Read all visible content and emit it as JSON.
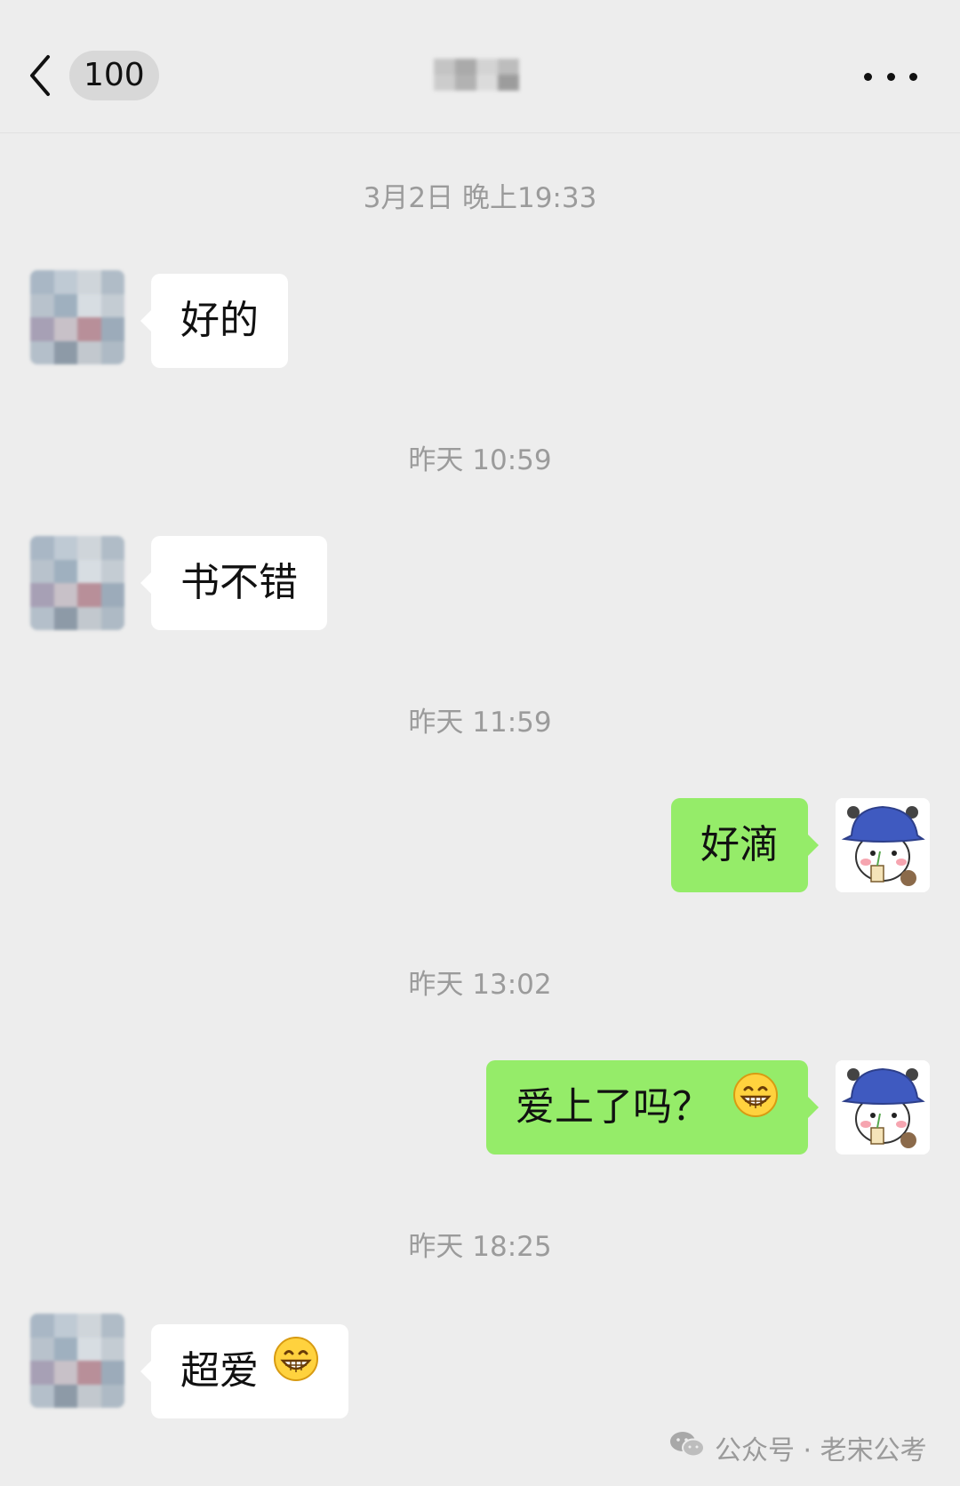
{
  "header": {
    "back_icon": "chevron-left-icon",
    "unread_count": "100",
    "more_icon": "more-dots-icon"
  },
  "messages": [
    {
      "timestamp": "3月2日 晚上19:33",
      "side": "left",
      "text": "好的"
    },
    {
      "timestamp": "昨天 10:59",
      "side": "left",
      "text": "书不错"
    },
    {
      "timestamp": "昨天 11:59",
      "side": "right",
      "text": "好滴"
    },
    {
      "timestamp": "昨天 13:02",
      "side": "right",
      "text": "爱上了吗？",
      "emoji": "grin-emoji"
    },
    {
      "timestamp": "昨天 18:25",
      "side": "left",
      "text": "超爱",
      "emoji": "grin-emoji"
    }
  ],
  "watermark": {
    "text": "公众号 · 老宋公考",
    "icon": "wechat-icon"
  },
  "colors": {
    "background": "#ededed",
    "bubble_self": "#95ec69",
    "bubble_other": "#ffffff",
    "timestamp": "#9b9b9b"
  }
}
